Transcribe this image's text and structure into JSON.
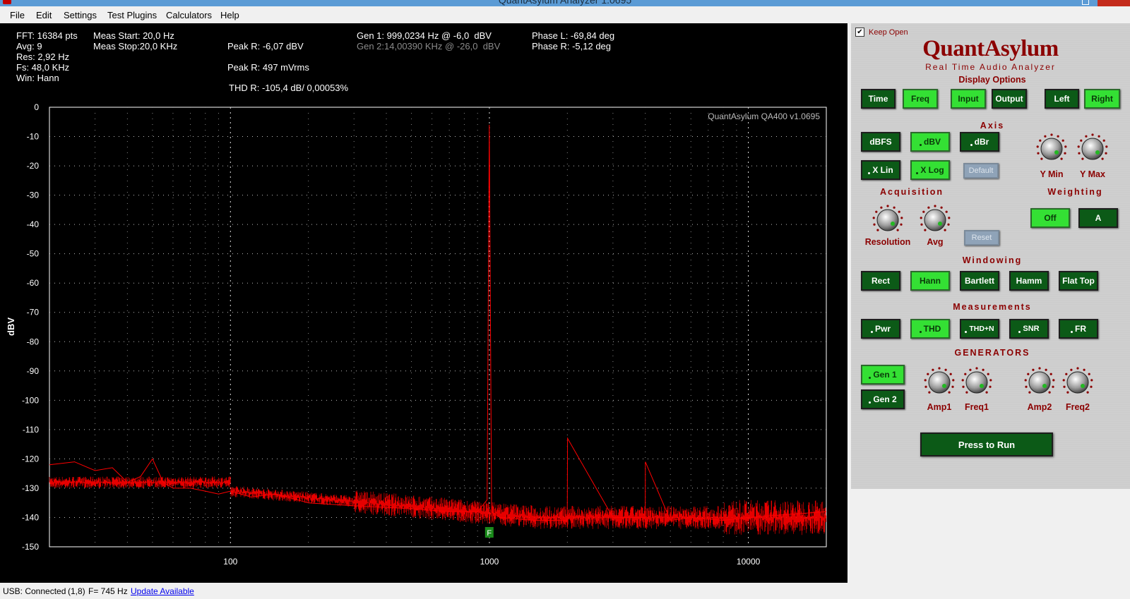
{
  "window": {
    "title": "QuantAsylum Analyzer 1.0695"
  },
  "menu": [
    "File",
    "Edit",
    "Settings",
    "Test Plugins",
    "Calculators",
    "Help"
  ],
  "readouts": {
    "fft": "FFT: 16384 pts",
    "avg": "Avg: 9",
    "res": "Res: 2,92 Hz",
    "fs": "Fs: 48,0 KHz",
    "win": "Win: Hann",
    "meas_start": "Meas Start: 20,0 Hz",
    "meas_stop": "Meas Stop:20,0 KHz",
    "peak_r_dbv": "Peak R: -6,07 dBV",
    "peak_r_mv": "Peak R: 497 mVrms",
    "thd_r": "THD R: -105,4 dB/ 0,00053%",
    "gen1": "Gen 1: 999,0234 Hz @ -6,0  dBV",
    "gen2": "Gen 2:14,00390 KHz @ -26,0  dBV",
    "phase_l": "Phase L: -69,84 deg",
    "phase_r": "Phase R: -5,12 deg"
  },
  "chart_data": {
    "type": "line",
    "watermark": "QuantAsylum QA400 v1.0695",
    "xlabel": "",
    "ylabel": "dBV",
    "x_scale": "log",
    "xlim": [
      20,
      20000
    ],
    "ylim": [
      -150,
      0
    ],
    "x_ticks": [
      "100",
      "1000",
      "10000"
    ],
    "y_ticks": [
      "0",
      "-10",
      "-20",
      "-30",
      "-40",
      "-50",
      "-60",
      "-70",
      "-80",
      "-90",
      "-100",
      "-110",
      "-120",
      "-130",
      "-140",
      "-150"
    ],
    "grid": true,
    "series": [
      {
        "color": "#ff0000",
        "x": [
          20,
          25,
          30,
          35,
          40,
          45,
          50,
          55,
          60,
          70,
          80,
          90,
          100,
          120,
          150,
          200,
          300,
          500,
          700,
          900,
          980,
          999,
          1020,
          1100,
          1500,
          1998,
          2003,
          3000,
          3996,
          4002,
          5000,
          6000,
          8000,
          10000,
          14000,
          20000
        ],
        "y": [
          -122,
          -121,
          -124,
          -123,
          -128,
          -126,
          -120,
          -128,
          -130,
          -130,
          -131,
          -132,
          -131,
          -133,
          -132,
          -135,
          -136,
          -137,
          -138,
          -138,
          -134,
          -6,
          -138,
          -140,
          -141,
          -141,
          -113,
          -140,
          -140,
          -121,
          -141,
          -140,
          -141,
          -140,
          -139,
          -138
        ]
      }
    ],
    "marker": "F"
  },
  "panel": {
    "keep_open": "Keep Open",
    "logo": "QuantAsylum",
    "subtitle": "Real Time Audio Analyzer",
    "sections": {
      "display": "Display Options",
      "axis": "Axis",
      "acquisition": "Acquisition",
      "weighting": "Weighting",
      "windowing": "Windowing",
      "measurements": "Measurements",
      "generators": "GENERATORS"
    },
    "display": [
      "Time",
      "Freq",
      "Input",
      "Output",
      "Left",
      "Right"
    ],
    "axis": [
      "dBFS",
      "dBV",
      "dBr",
      "X Lin",
      "X Log",
      "Default"
    ],
    "knobs": {
      "ymin": "Y Min",
      "ymax": "Y Max",
      "resolution": "Resolution",
      "avg": "Avg",
      "amp1": "Amp1",
      "freq1": "Freq1",
      "amp2": "Amp2",
      "freq2": "Freq2"
    },
    "reset": "Reset",
    "weighting": [
      "Off",
      "A"
    ],
    "windowing": [
      "Rect",
      "Hann",
      "Bartlett",
      "Hamm",
      "Flat Top"
    ],
    "measurements": [
      "Pwr",
      "THD",
      "THD+N",
      "SNR",
      "FR"
    ],
    "generators": [
      "Gen 1",
      "Gen 2"
    ],
    "run": "Press to Run"
  },
  "status": {
    "usb": "USB: Connected",
    "coords": "(1,8)",
    "freq": "F= 745 Hz",
    "update": "Update Available"
  }
}
